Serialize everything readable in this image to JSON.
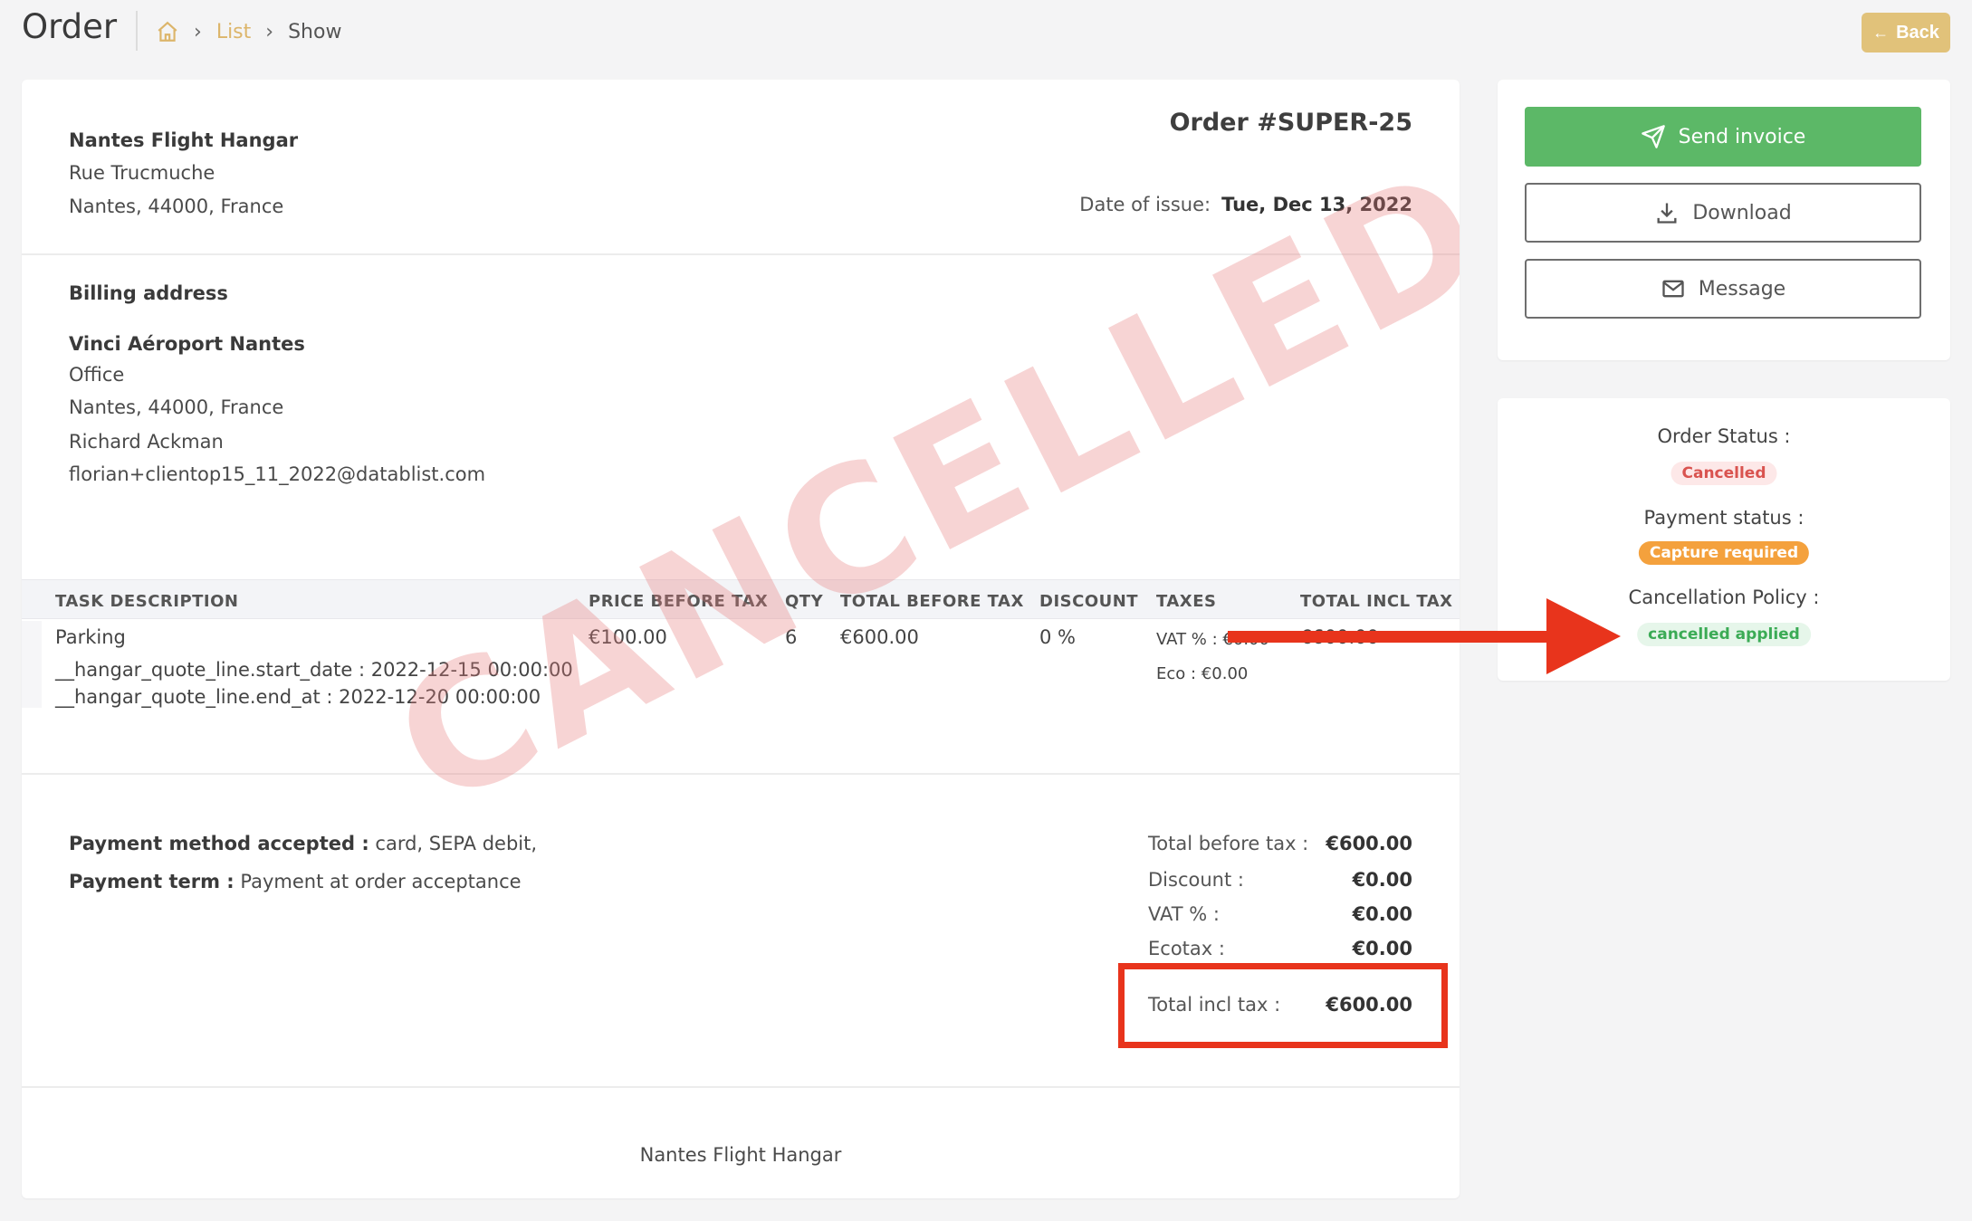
{
  "header": {
    "title": "Order",
    "breadcrumb": {
      "list": "List",
      "show": "Show"
    },
    "back_label": "Back"
  },
  "invoice": {
    "seller": {
      "name": "Nantes Flight Hangar",
      "street": "Rue Trucmuche",
      "city_line": "Nantes,  44000,  France"
    },
    "order_title": "Order #SUPER-25",
    "date_label": "Date of issue:",
    "date_value": "Tue, Dec 13, 2022",
    "billing": {
      "heading": "Billing address",
      "name": "Vinci Aéroport Nantes",
      "line1": "Office",
      "city_line": "Nantes,  44000,  France",
      "contact": "Richard Ackman",
      "email": "florian+clientop15_11_2022@datablist.com"
    },
    "table": {
      "headers": [
        "TASK DESCRIPTION",
        "PRICE BEFORE TAX",
        "QTY",
        "TOTAL BEFORE TAX",
        "DISCOUNT",
        "TAXES",
        "TOTAL INCL TAX"
      ],
      "row": {
        "description": "Parking",
        "meta1": "__hangar_quote_line.start_date : 2022-12-15 00:00:00",
        "meta2": "__hangar_quote_line.end_at : 2022-12-20 00:00:00",
        "price": "€100.00",
        "qty": "6",
        "total_before": "€600.00",
        "discount": "0 %",
        "tax_vat_label": "VAT % :",
        "tax_vat_value": "€0.00",
        "tax_eco_label": "Eco :",
        "tax_eco_value": "€0.00",
        "total_incl": "€600.00"
      }
    },
    "payment": {
      "method_label": "Payment method accepted :",
      "method_value": "card, SEPA debit,",
      "term_label": "Payment term :",
      "term_value": "Payment at order acceptance"
    },
    "totals": {
      "before_tax_label": "Total before tax :",
      "before_tax": "€600.00",
      "discount_label": "Discount :",
      "discount": "€0.00",
      "vat_label": "VAT % :",
      "vat": "€0.00",
      "ecotax_label": "Ecotax :",
      "ecotax": "€0.00",
      "incl_label": "Total incl tax :",
      "incl": "€600.00"
    },
    "footer": "Nantes Flight Hangar",
    "watermark": "CANCELLED"
  },
  "actions": {
    "send": "Send invoice",
    "download": "Download",
    "message": "Message"
  },
  "status": {
    "order_label": "Order Status :",
    "order_value": "Cancelled",
    "payment_label": "Payment status :",
    "payment_value": "Capture required",
    "policy_label": "Cancellation Policy :",
    "policy_value": "cancelled applied"
  },
  "colors": {
    "accent": "#e1c27a",
    "send": "#5cb867",
    "annotation": "#e8341c"
  }
}
